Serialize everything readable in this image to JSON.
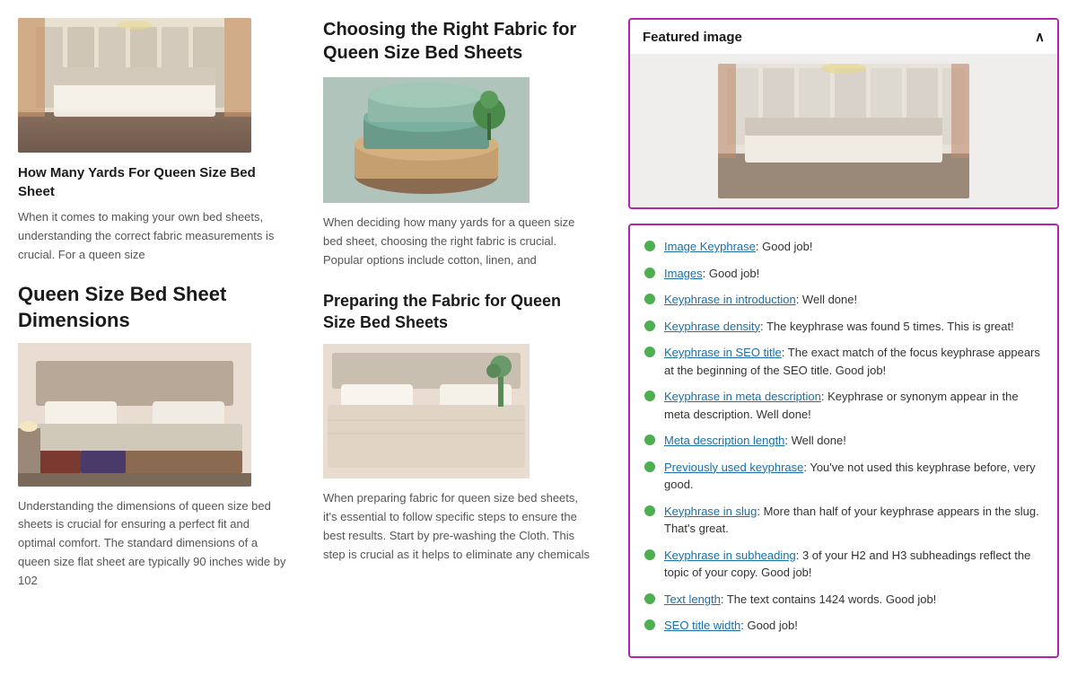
{
  "left": {
    "article1": {
      "title": "How Many Yards For Queen Size Bed Sheet",
      "title_display": "How Many Yards For Queen Size Bed Sheet",
      "body": "When it comes to making your own bed sheets, understanding the correct fabric measurements is crucial. For a queen size"
    },
    "article2": {
      "heading": "Queen Size Bed Sheet Dimensions",
      "body": "Understanding the dimensions of queen size bed sheets is crucial for ensuring a perfect fit and optimal comfort. The standard dimensions of a queen size flat sheet are typically 90 inches wide by 102"
    }
  },
  "middle": {
    "section1": {
      "heading": "Choosing the Right Fabric for Queen Size Bed Sheets",
      "body": "When deciding how many yards for a queen size bed sheet, choosing the right fabric is crucial. Popular options include cotton, linen, and"
    },
    "section2": {
      "heading": "Preparing the Fabric for Queen Size Bed Sheets",
      "body": "When preparing fabric for queen size bed sheets, it's essential to follow specific steps to ensure the best results. Start by pre-washing the Cloth. This step is crucial as it helps to eliminate any chemicals"
    }
  },
  "right": {
    "featured_image": {
      "title": "Featured image",
      "collapse_icon": "∧"
    },
    "seo": {
      "items": [
        {
          "link": "Image Keyphrase",
          "text": ": Good job!"
        },
        {
          "link": "Images",
          "text": ": Good job!"
        },
        {
          "link": "Keyphrase in introduction",
          "text": ": Well done!"
        },
        {
          "link": "Keyphrase density",
          "text": ": The keyphrase was found 5 times. This is great!"
        },
        {
          "link": "Keyphrase in SEO title",
          "text": ": The exact match of the focus keyphrase appears at the beginning of the SEO title. Good job!"
        },
        {
          "link": "Keyphrase in meta description",
          "text": ": Keyphrase or synonym appear in the meta description. Well done!"
        },
        {
          "link": "Meta description length",
          "text": ": Well done!"
        },
        {
          "link": "Previously used keyphrase",
          "text": ": You've not used this keyphrase before, very good."
        },
        {
          "link": "Keyphrase in slug",
          "text": ": More than half of your keyphrase appears in the slug. That's great."
        },
        {
          "link": "Keyphrase in subheading",
          "text": ": 3 of your H2 and H3 subheadings reflect the topic of your copy. Good job!"
        },
        {
          "link": "Text length",
          "text": ": The text contains 1424 words. Good job!"
        },
        {
          "link": "SEO title width",
          "text": ": Good job!"
        }
      ]
    }
  }
}
